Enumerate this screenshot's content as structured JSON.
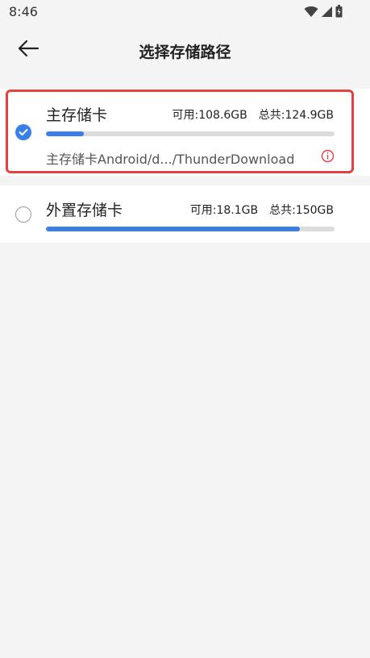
{
  "status_bar": {
    "time": "8:46",
    "icons": [
      "wifi-icon",
      "signal-icon",
      "battery-icon"
    ]
  },
  "header": {
    "title": "选择存储路径",
    "back_icon": "arrow-left-icon"
  },
  "storage_options": [
    {
      "name": "主存储卡",
      "available": "可用:108.6GB",
      "total": "总共:124.9GB",
      "used_fraction": 0.13,
      "path": "主存储卡Android/d.../ThunderDownload",
      "selected": true
    },
    {
      "name": "外置存储卡",
      "available": "可用:18.1GB",
      "total": "总共:150GB",
      "used_fraction": 0.88,
      "selected": false
    }
  ],
  "colors": {
    "accent": "#3a7fe8",
    "highlight": "#e5413f",
    "info": "#e5413f",
    "track": "#dcdcdc"
  }
}
